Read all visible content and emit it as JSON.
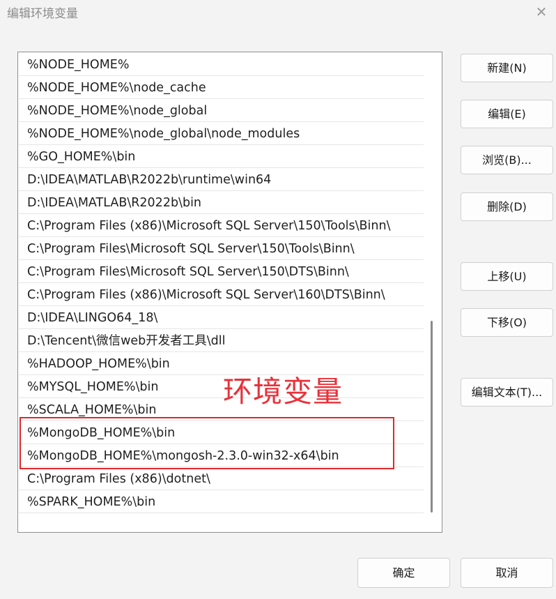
{
  "window": {
    "title": "编辑环境变量",
    "close_symbol": "✕"
  },
  "list": {
    "items": [
      "%NODE_HOME%",
      "%NODE_HOME%\\node_cache",
      "%NODE_HOME%\\node_global",
      "%NODE_HOME%\\node_global\\node_modules",
      "%GO_HOME%\\bin",
      "D:\\IDEA\\MATLAB\\R2022b\\runtime\\win64",
      "D:\\IDEA\\MATLAB\\R2022b\\bin",
      "C:\\Program Files (x86)\\Microsoft SQL Server\\150\\Tools\\Binn\\",
      "C:\\Program Files\\Microsoft SQL Server\\150\\Tools\\Binn\\",
      "C:\\Program Files\\Microsoft SQL Server\\150\\DTS\\Binn\\",
      "C:\\Program Files (x86)\\Microsoft SQL Server\\160\\DTS\\Binn\\",
      "D:\\IDEA\\LINGO64_18\\",
      "D:\\Tencent\\微信web开发者工具\\dll",
      "%HADOOP_HOME%\\bin",
      "%MYSQL_HOME%\\bin",
      "%SCALA_HOME%\\bin",
      "%MongoDB_HOME%\\bin",
      "%MongoDB_HOME%\\mongosh-2.3.0-win32-x64\\bin",
      "C:\\Program Files (x86)\\dotnet\\",
      "%SPARK_HOME%\\bin"
    ]
  },
  "annotation": {
    "text": "环境变量",
    "color": "#e8313a"
  },
  "buttons": {
    "new": "新建(N)",
    "edit": "编辑(E)",
    "browse": "浏览(B)...",
    "delete": "删除(D)",
    "move_up": "上移(U)",
    "move_down": "下移(O)",
    "edit_text": "编辑文本(T)...",
    "ok": "确定",
    "cancel": "取消"
  }
}
